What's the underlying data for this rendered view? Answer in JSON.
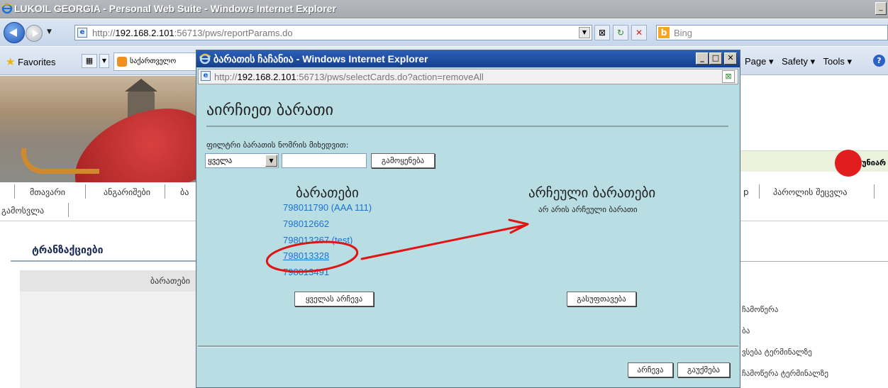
{
  "main_window": {
    "title": "LUKOIL GEORGIA - Personal Web Suite - Windows Internet Explorer",
    "url_prefix": "http://",
    "url_host": "192.168.2.101",
    "url_rest": ":56713/pws/reportParams.do",
    "search_engine": "Bing",
    "favorites_label": "Favorites",
    "tab_label": "საქართველო",
    "menus": [
      "Page ▾",
      "Safety ▾",
      "Tools ▾"
    ]
  },
  "background_page": {
    "nav_items": [
      "მთავარი",
      "ანგარიშები",
      "ბა",
      "პაროლის შეცვლა"
    ],
    "nav_row2": [
      "გამოსვლა"
    ],
    "nav_hidden_right": "p",
    "section_title": "ტრანზაქციები",
    "cards_header": "ბარათები",
    "right_column": [
      "ჩამოწერა",
      "ბა",
      "ვსება ტერმინალზე",
      "ჩამოწერა ტერმინალზე"
    ],
    "logo_text": "უნიარ"
  },
  "popup": {
    "title": "ბარათის ჩაჩანია - Windows Internet Explorer",
    "url_prefix": "http://",
    "url_host": "192.168.2.101",
    "url_rest": ":56713/pws/selectCards.do?action=removeAll",
    "heading": "აირჩიეთ ბარათი",
    "filter_label": "ფილტრი ბარათის ნომრის მიხედვით:",
    "filter_select": "ყველა",
    "filter_input": "",
    "apply_button": "გამოყენება",
    "cards_heading": "ბარათები",
    "selected_heading": "არჩეული ბარათები",
    "no_selected": "არ არის არჩეული ბარათი",
    "cards": [
      "798011790 (AAA 111)",
      "798012662",
      "798013267 (test)",
      "798013328",
      "798013491"
    ],
    "select_all_button": "ყველას არჩევა",
    "clear_button": "გასუფთავება",
    "ok_button": "არჩევა",
    "cancel_button": "გაუქმება"
  },
  "annotation": {
    "color": "#e01414"
  }
}
